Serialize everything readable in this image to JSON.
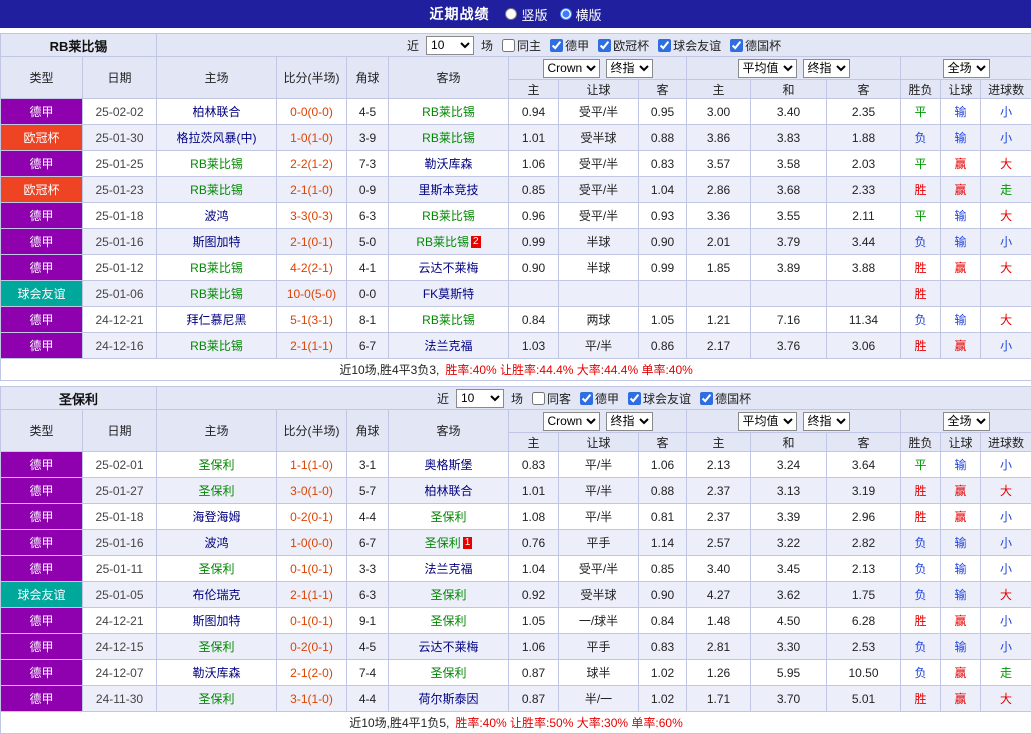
{
  "topbar": {
    "title": "近期战绩",
    "options": [
      {
        "label": "竖版",
        "selected": false
      },
      {
        "label": "横版",
        "selected": true
      }
    ]
  },
  "colors": {
    "topbar_bg": "#20209e",
    "header_bg": "#e3e6f5",
    "row_alt_bg": "#eceffa",
    "focus_team": "#008800",
    "opponent_team": "#000080",
    "score": "#dd4300",
    "win": "#e60000",
    "draw": "#009900",
    "lose": "#2244dd",
    "league": {
      "德甲": "#8f00af",
      "欧冠杯": "#ee4423",
      "球会友谊": "#00a79b"
    }
  },
  "sections": [
    {
      "team": "RB莱比锡",
      "filter": {
        "near_label": "近",
        "count": "10",
        "matches_label": "场",
        "checkboxes": [
          {
            "label": "同主",
            "checked": false
          },
          {
            "label": "德甲",
            "checked": true
          },
          {
            "label": "欧冠杯",
            "checked": true
          },
          {
            "label": "球会友谊",
            "checked": true
          },
          {
            "label": "德国杯",
            "checked": true
          }
        ]
      },
      "dropdowns": {
        "asia": [
          "Crown",
          "终指"
        ],
        "europe": [
          "平均值",
          "终指"
        ],
        "scope": [
          "全场"
        ]
      },
      "columns": {
        "left": [
          "类型",
          "日期",
          "主场",
          "比分(半场)",
          "角球",
          "客场"
        ],
        "odds": [
          "主",
          "让球",
          "客",
          "主",
          "和",
          "客",
          "胜负",
          "让球",
          "进球数"
        ]
      },
      "rows": [
        {
          "league": "德甲",
          "date": "25-02-02",
          "home": "柏林联合",
          "home_focus": false,
          "home_card": "",
          "score": "0-0(0-0)",
          "corner": "4-5",
          "away": "RB莱比锡",
          "away_focus": true,
          "away_card": "",
          "asia": [
            "0.94",
            "受平/半",
            "0.95"
          ],
          "europe": [
            "3.00",
            "3.40",
            "2.35"
          ],
          "result": "平",
          "cover": "输",
          "goals": "小"
        },
        {
          "league": "欧冠杯",
          "date": "25-01-30",
          "home": "格拉茨风暴(中)",
          "home_focus": false,
          "home_card": "",
          "score": "1-0(1-0)",
          "corner": "3-9",
          "away": "RB莱比锡",
          "away_focus": true,
          "away_card": "",
          "asia": [
            "1.01",
            "受半球",
            "0.88"
          ],
          "europe": [
            "3.86",
            "3.83",
            "1.88"
          ],
          "result": "负",
          "cover": "输",
          "goals": "小"
        },
        {
          "league": "德甲",
          "date": "25-01-25",
          "home": "RB莱比锡",
          "home_focus": true,
          "home_card": "",
          "score": "2-2(1-2)",
          "corner": "7-3",
          "away": "勒沃库森",
          "away_focus": false,
          "away_card": "",
          "asia": [
            "1.06",
            "受平/半",
            "0.83"
          ],
          "europe": [
            "3.57",
            "3.58",
            "2.03"
          ],
          "result": "平",
          "cover": "赢",
          "goals": "大"
        },
        {
          "league": "欧冠杯",
          "date": "25-01-23",
          "home": "RB莱比锡",
          "home_focus": true,
          "home_card": "",
          "score": "2-1(1-0)",
          "corner": "0-9",
          "away": "里斯本竞技",
          "away_focus": false,
          "away_card": "",
          "asia": [
            "0.85",
            "受平/半",
            "1.04"
          ],
          "europe": [
            "2.86",
            "3.68",
            "2.33"
          ],
          "result": "胜",
          "cover": "赢",
          "goals": "走"
        },
        {
          "league": "德甲",
          "date": "25-01-18",
          "home": "波鸿",
          "home_focus": false,
          "home_card": "",
          "score": "3-3(0-3)",
          "corner": "6-3",
          "away": "RB莱比锡",
          "away_focus": true,
          "away_card": "",
          "asia": [
            "0.96",
            "受平/半",
            "0.93"
          ],
          "europe": [
            "3.36",
            "3.55",
            "2.11"
          ],
          "result": "平",
          "cover": "输",
          "goals": "大"
        },
        {
          "league": "德甲",
          "date": "25-01-16",
          "home": "斯图加特",
          "home_focus": false,
          "home_card": "",
          "score": "2-1(0-1)",
          "corner": "5-0",
          "away": "RB莱比锡",
          "away_focus": true,
          "away_card": "2",
          "asia": [
            "0.99",
            "半球",
            "0.90"
          ],
          "europe": [
            "2.01",
            "3.79",
            "3.44"
          ],
          "result": "负",
          "cover": "输",
          "goals": "小"
        },
        {
          "league": "德甲",
          "date": "25-01-12",
          "home": "RB莱比锡",
          "home_focus": true,
          "home_card": "",
          "score": "4-2(2-1)",
          "corner": "4-1",
          "away": "云达不莱梅",
          "away_focus": false,
          "away_card": "",
          "asia": [
            "0.90",
            "半球",
            "0.99"
          ],
          "europe": [
            "1.85",
            "3.89",
            "3.88"
          ],
          "result": "胜",
          "cover": "赢",
          "goals": "大"
        },
        {
          "league": "球会友谊",
          "date": "25-01-06",
          "home": "RB莱比锡",
          "home_focus": true,
          "home_card": "",
          "score": "10-0(5-0)",
          "corner": "0-0",
          "away": "FK莫斯特",
          "away_focus": false,
          "away_card": "",
          "asia": [
            "",
            "",
            ""
          ],
          "europe": [
            "",
            "",
            ""
          ],
          "result": "胜",
          "cover": "",
          "goals": ""
        },
        {
          "league": "德甲",
          "date": "24-12-21",
          "home": "拜仁慕尼黑",
          "home_focus": false,
          "home_card": "",
          "score": "5-1(3-1)",
          "corner": "8-1",
          "away": "RB莱比锡",
          "away_focus": true,
          "away_card": "",
          "asia": [
            "0.84",
            "两球",
            "1.05"
          ],
          "europe": [
            "1.21",
            "7.16",
            "11.34"
          ],
          "result": "负",
          "cover": "输",
          "goals": "大"
        },
        {
          "league": "德甲",
          "date": "24-12-16",
          "home": "RB莱比锡",
          "home_focus": true,
          "home_card": "",
          "score": "2-1(1-1)",
          "corner": "6-7",
          "away": "法兰克福",
          "away_focus": false,
          "away_card": "",
          "asia": [
            "1.03",
            "平/半",
            "0.86"
          ],
          "europe": [
            "2.17",
            "3.76",
            "3.06"
          ],
          "result": "胜",
          "cover": "赢",
          "goals": "小"
        }
      ],
      "summary": {
        "prefix": "近10场,胜4平3负3,",
        "stats": "胜率:40%  让胜率:44.4%  大率:44.4%  单率:40%"
      }
    },
    {
      "team": "圣保利",
      "filter": {
        "near_label": "近",
        "count": "10",
        "matches_label": "场",
        "checkboxes": [
          {
            "label": "同客",
            "checked": false
          },
          {
            "label": "德甲",
            "checked": true
          },
          {
            "label": "球会友谊",
            "checked": true
          },
          {
            "label": "德国杯",
            "checked": true
          }
        ]
      },
      "dropdowns": {
        "asia": [
          "Crown",
          "终指"
        ],
        "europe": [
          "平均值",
          "终指"
        ],
        "scope": [
          "全场"
        ]
      },
      "columns": {
        "left": [
          "类型",
          "日期",
          "主场",
          "比分(半场)",
          "角球",
          "客场"
        ],
        "odds": [
          "主",
          "让球",
          "客",
          "主",
          "和",
          "客",
          "胜负",
          "让球",
          "进球数"
        ]
      },
      "rows": [
        {
          "league": "德甲",
          "date": "25-02-01",
          "home": "圣保利",
          "home_focus": true,
          "home_card": "",
          "score": "1-1(1-0)",
          "corner": "3-1",
          "away": "奥格斯堡",
          "away_focus": false,
          "away_card": "",
          "asia": [
            "0.83",
            "平/半",
            "1.06"
          ],
          "europe": [
            "2.13",
            "3.24",
            "3.64"
          ],
          "result": "平",
          "cover": "输",
          "goals": "小"
        },
        {
          "league": "德甲",
          "date": "25-01-27",
          "home": "圣保利",
          "home_focus": true,
          "home_card": "",
          "score": "3-0(1-0)",
          "corner": "5-7",
          "away": "柏林联合",
          "away_focus": false,
          "away_card": "",
          "asia": [
            "1.01",
            "平/半",
            "0.88"
          ],
          "europe": [
            "2.37",
            "3.13",
            "3.19"
          ],
          "result": "胜",
          "cover": "赢",
          "goals": "大"
        },
        {
          "league": "德甲",
          "date": "25-01-18",
          "home": "海登海姆",
          "home_focus": false,
          "home_card": "",
          "score": "0-2(0-1)",
          "corner": "4-4",
          "away": "圣保利",
          "away_focus": true,
          "away_card": "",
          "asia": [
            "1.08",
            "平/半",
            "0.81"
          ],
          "europe": [
            "2.37",
            "3.39",
            "2.96"
          ],
          "result": "胜",
          "cover": "赢",
          "goals": "小"
        },
        {
          "league": "德甲",
          "date": "25-01-16",
          "home": "波鸿",
          "home_focus": false,
          "home_card": "",
          "score": "1-0(0-0)",
          "corner": "6-7",
          "away": "圣保利",
          "away_focus": true,
          "away_card": "1",
          "asia": [
            "0.76",
            "平手",
            "1.14"
          ],
          "europe": [
            "2.57",
            "3.22",
            "2.82"
          ],
          "result": "负",
          "cover": "输",
          "goals": "小"
        },
        {
          "league": "德甲",
          "date": "25-01-11",
          "home": "圣保利",
          "home_focus": true,
          "home_card": "",
          "score": "0-1(0-1)",
          "corner": "3-3",
          "away": "法兰克福",
          "away_focus": false,
          "away_card": "",
          "asia": [
            "1.04",
            "受平/半",
            "0.85"
          ],
          "europe": [
            "3.40",
            "3.45",
            "2.13"
          ],
          "result": "负",
          "cover": "输",
          "goals": "小"
        },
        {
          "league": "球会友谊",
          "date": "25-01-05",
          "home": "布伦瑞克",
          "home_focus": false,
          "home_card": "",
          "score": "2-1(1-1)",
          "corner": "6-3",
          "away": "圣保利",
          "away_focus": true,
          "away_card": "",
          "asia": [
            "0.92",
            "受半球",
            "0.90"
          ],
          "europe": [
            "4.27",
            "3.62",
            "1.75"
          ],
          "result": "负",
          "cover": "输",
          "goals": "大"
        },
        {
          "league": "德甲",
          "date": "24-12-21",
          "home": "斯图加特",
          "home_focus": false,
          "home_card": "",
          "score": "0-1(0-1)",
          "corner": "9-1",
          "away": "圣保利",
          "away_focus": true,
          "away_card": "",
          "asia": [
            "1.05",
            "一/球半",
            "0.84"
          ],
          "europe": [
            "1.48",
            "4.50",
            "6.28"
          ],
          "result": "胜",
          "cover": "赢",
          "goals": "小"
        },
        {
          "league": "德甲",
          "date": "24-12-15",
          "home": "圣保利",
          "home_focus": true,
          "home_card": "",
          "score": "0-2(0-1)",
          "corner": "4-5",
          "away": "云达不莱梅",
          "away_focus": false,
          "away_card": "",
          "asia": [
            "1.06",
            "平手",
            "0.83"
          ],
          "europe": [
            "2.81",
            "3.30",
            "2.53"
          ],
          "result": "负",
          "cover": "输",
          "goals": "小"
        },
        {
          "league": "德甲",
          "date": "24-12-07",
          "home": "勒沃库森",
          "home_focus": false,
          "home_card": "",
          "score": "2-1(2-0)",
          "corner": "7-4",
          "away": "圣保利",
          "away_focus": true,
          "away_card": "",
          "asia": [
            "0.87",
            "球半",
            "1.02"
          ],
          "europe": [
            "1.26",
            "5.95",
            "10.50"
          ],
          "result": "负",
          "cover": "赢",
          "goals": "走"
        },
        {
          "league": "德甲",
          "date": "24-11-30",
          "home": "圣保利",
          "home_focus": true,
          "home_card": "",
          "score": "3-1(1-0)",
          "corner": "4-4",
          "away": "荷尔斯泰因",
          "away_focus": false,
          "away_card": "",
          "asia": [
            "0.87",
            "半/一",
            "1.02"
          ],
          "europe": [
            "1.71",
            "3.70",
            "5.01"
          ],
          "result": "胜",
          "cover": "赢",
          "goals": "大"
        }
      ],
      "summary": {
        "prefix": "近10场,胜4平1负5,",
        "stats": "胜率:40%  让胜率:50%  大率:30%  单率:60%"
      }
    }
  ]
}
